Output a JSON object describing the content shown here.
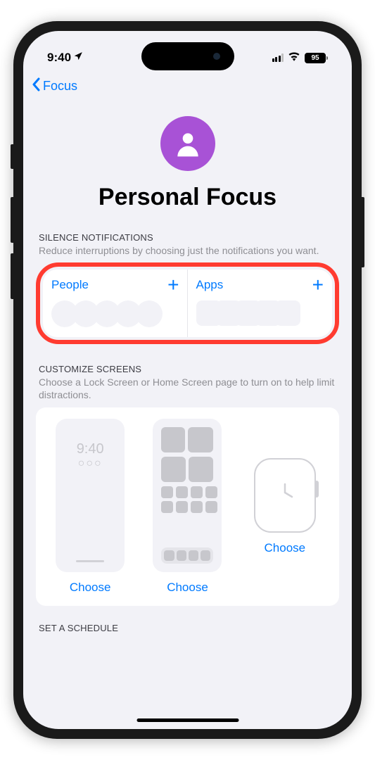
{
  "status_bar": {
    "time": "9:40",
    "battery": "95"
  },
  "nav": {
    "back_label": "Focus"
  },
  "header": {
    "title": "Personal Focus"
  },
  "silence_section": {
    "header": "SILENCE NOTIFICATIONS",
    "subtitle": "Reduce interruptions by choosing just the notifications you want.",
    "people_label": "People",
    "apps_label": "Apps"
  },
  "customize_section": {
    "header": "CUSTOMIZE SCREENS",
    "subtitle": "Choose a Lock Screen or Home Screen page to turn on to help limit distractions.",
    "mock_time": "9:40",
    "choose_label": "Choose"
  },
  "schedule_section": {
    "header": "SET A SCHEDULE"
  }
}
